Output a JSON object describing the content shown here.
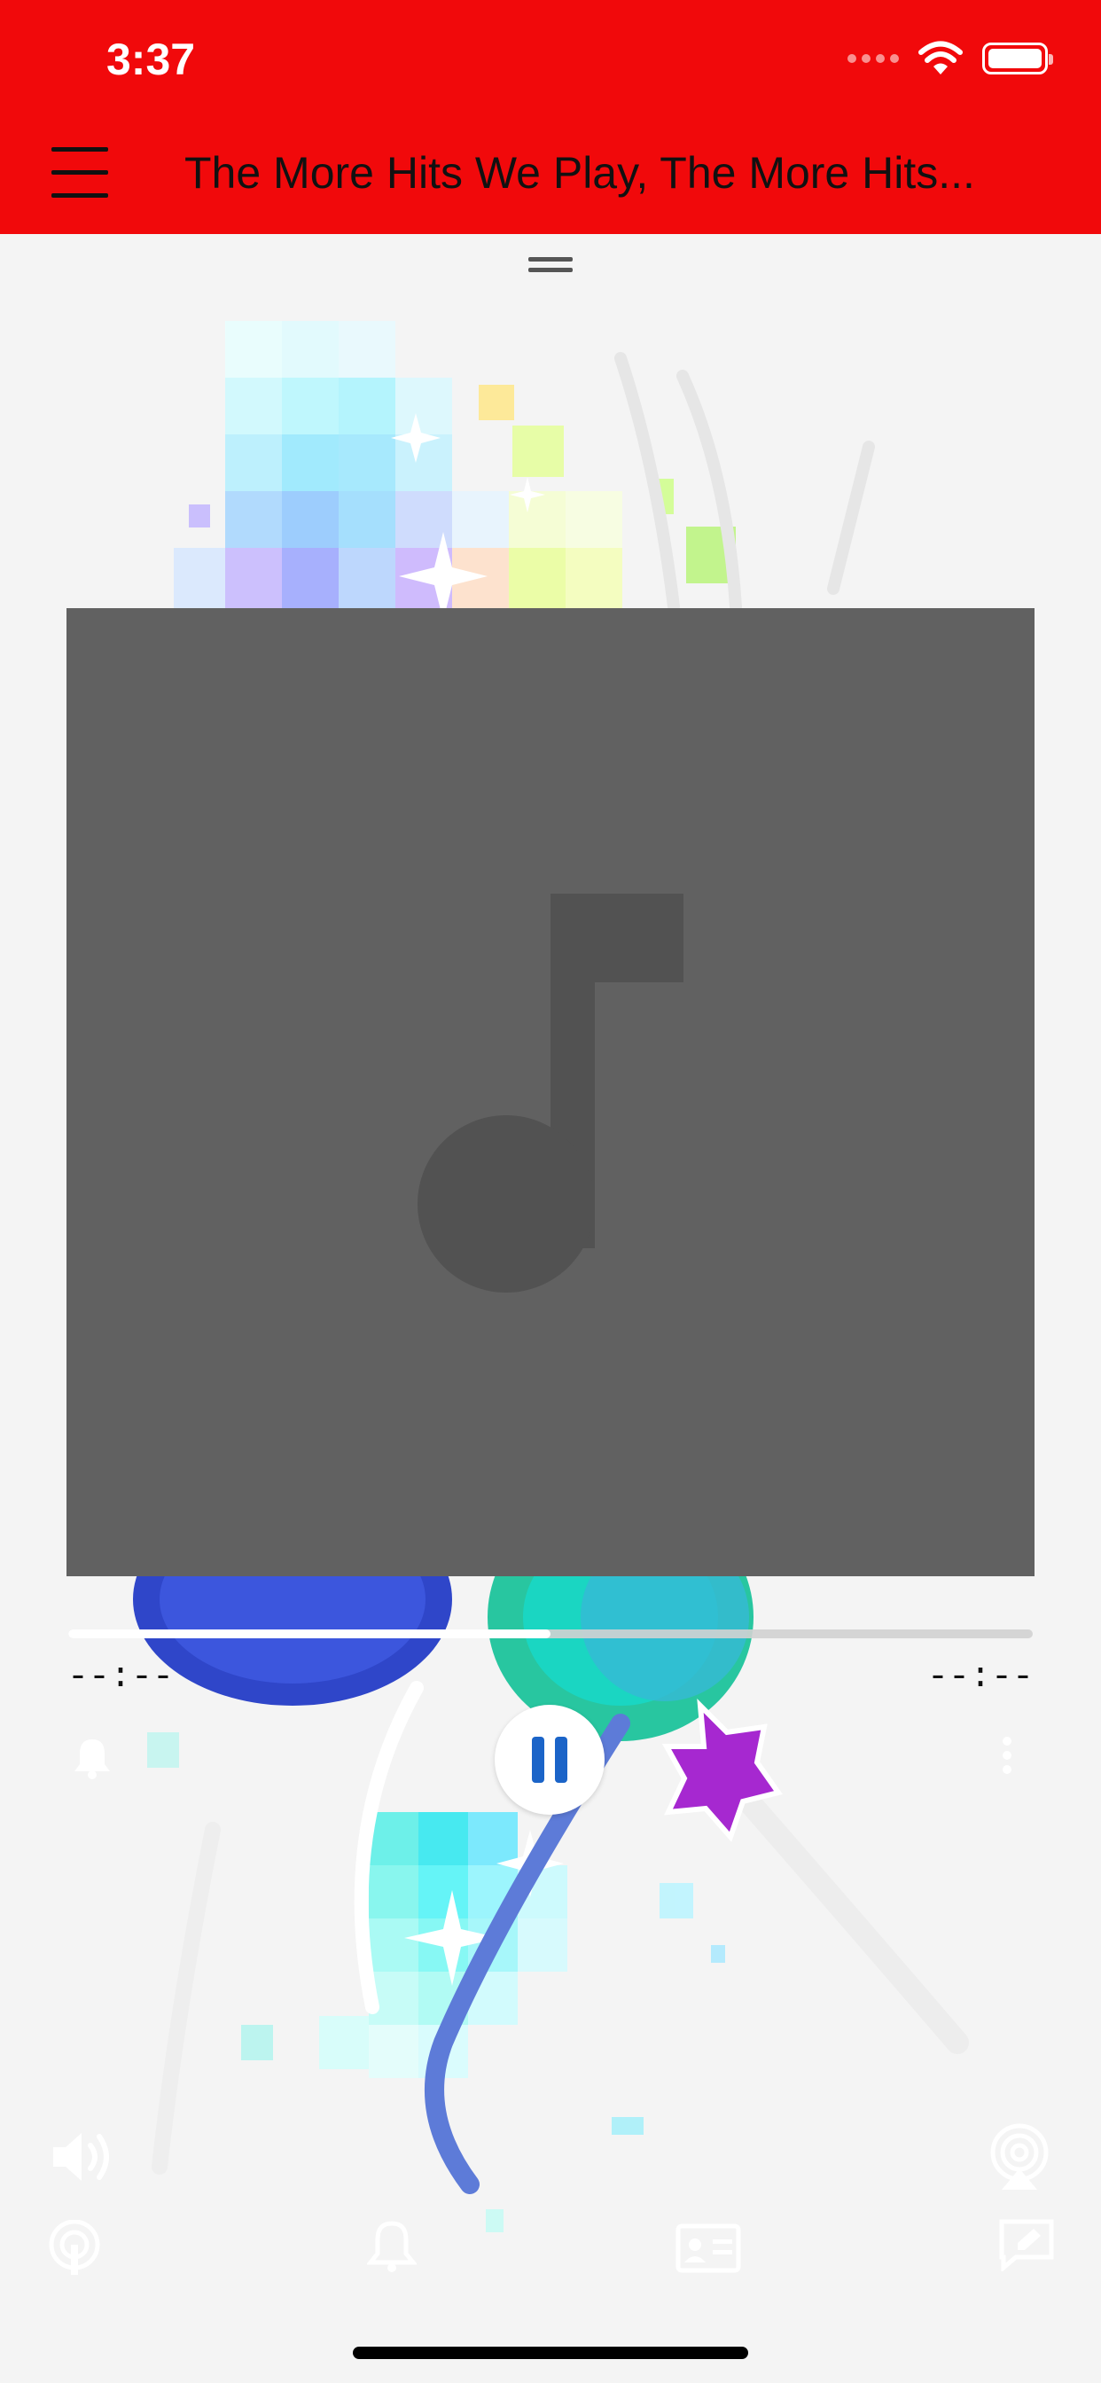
{
  "status_bar": {
    "time": "3:37"
  },
  "header": {
    "title": "The More Hits We Play, The More Hits..."
  },
  "player": {
    "elapsed": "--:--",
    "remaining": "--:--",
    "progress_fraction": 0.5
  },
  "icons": {
    "menu": "hamburger-menu-icon",
    "drag": "drag-handle-icon",
    "artwork": "music-note-icon",
    "alarm": "bell-icon",
    "more": "more-vertical-icon",
    "pause": "pause-icon",
    "volume": "speaker-icon",
    "airplay": "airplay-icon",
    "radio": "podcast-icon",
    "notifications": "bell-icon",
    "contact": "contact-card-icon",
    "feedback": "message-edit-icon"
  },
  "colors": {
    "header_bg": "#f1090b",
    "artwork_bg": "#616161",
    "pause_glyph": "#1b64c8"
  }
}
